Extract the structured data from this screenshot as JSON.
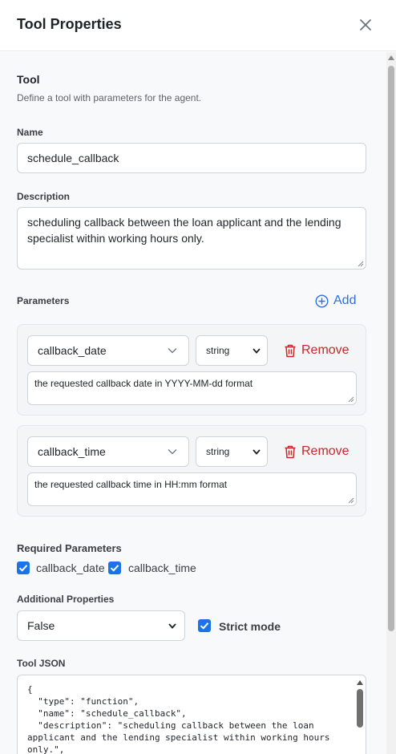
{
  "header": {
    "title": "Tool Properties",
    "close_icon": "close-icon"
  },
  "tool": {
    "section_title": "Tool",
    "section_desc": "Define a tool with parameters for the agent.",
    "name_label": "Name",
    "name_value": "schedule_callback",
    "description_label": "Description",
    "description_value": "scheduling callback between the loan applicant and the lending specialist within working hours only."
  },
  "parameters": {
    "label": "Parameters",
    "add_label": "Add",
    "remove_label": "Remove",
    "items": [
      {
        "name": "callback_date",
        "type": "string",
        "description": "the requested callback date in YYYY-MM-dd format"
      },
      {
        "name": "callback_time",
        "type": "string",
        "description": "the requested callback time in HH:mm format"
      }
    ]
  },
  "required": {
    "label": "Required Parameters",
    "items": [
      {
        "label": "callback_date",
        "checked": true
      },
      {
        "label": "callback_time",
        "checked": true
      }
    ]
  },
  "additional": {
    "label": "Additional Properties",
    "value": "False",
    "strict_label": "Strict mode",
    "strict_checked": true
  },
  "tool_json": {
    "label": "Tool JSON",
    "text": "{\n  \"type\": \"function\",\n  \"name\": \"schedule_callback\",\n  \"description\": \"scheduling callback between the loan applicant and the lending specialist within working hours only.\","
  },
  "colors": {
    "accent": "#1a73e8",
    "link": "#2f6fdf",
    "danger": "#c62828"
  }
}
